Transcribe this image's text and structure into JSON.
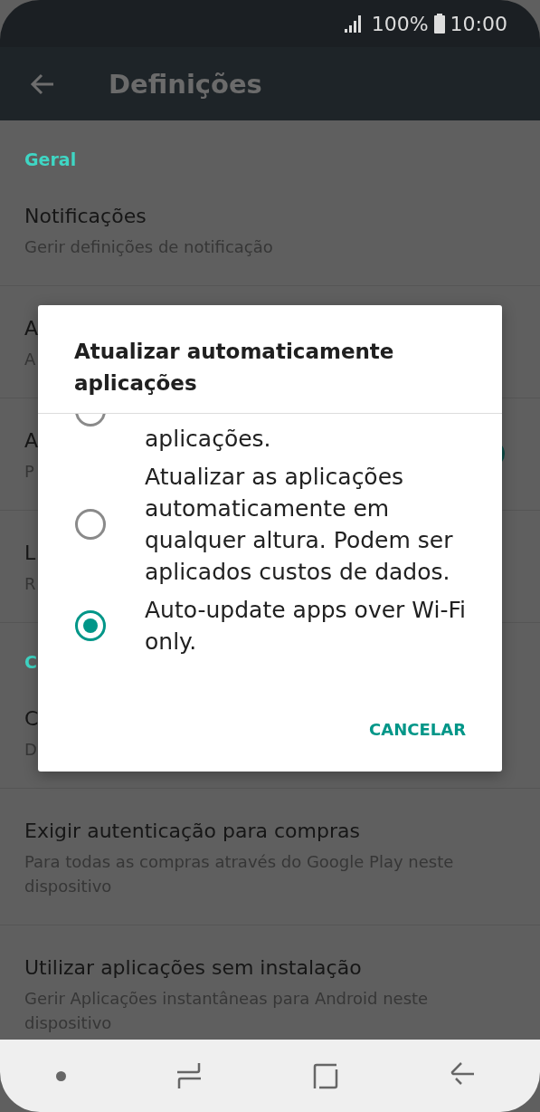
{
  "status_bar": {
    "battery": "100%",
    "time": "10:00"
  },
  "app_bar": {
    "title": "Definições"
  },
  "settings": [
    {
      "kind": "header",
      "title": "Geral"
    },
    {
      "kind": "item",
      "title": "Notificações",
      "subtitle": "Gerir definições de notificação"
    },
    {
      "kind": "item",
      "title": "A",
      "subtitle": "A"
    },
    {
      "kind": "toggle",
      "title": "A",
      "subtitle": "P",
      "on": true
    },
    {
      "kind": "item",
      "title": "L",
      "subtitle": "R"
    },
    {
      "kind": "header",
      "title": "C"
    },
    {
      "kind": "item",
      "title": "C",
      "subtitle": "D"
    },
    {
      "kind": "item",
      "title": "Exigir autenticação para compras",
      "subtitle": "Para todas as compras através do Google Play neste dispositivo"
    },
    {
      "kind": "item",
      "title": "Utilizar aplicações sem instalação",
      "subtitle": "Gerir Aplicações instantâneas para Android neste dispositivo"
    }
  ],
  "dialog": {
    "title": "Atualizar automaticamente aplicações",
    "options": [
      {
        "label": "aplicações.",
        "selected": false
      },
      {
        "label": "Atualizar as aplicações automaticamente em qualquer altura. Podem ser aplicados custos de dados.",
        "selected": false
      },
      {
        "label": "Auto-update apps over Wi-Fi only.",
        "selected": true
      }
    ],
    "button": "CANCELAR"
  }
}
